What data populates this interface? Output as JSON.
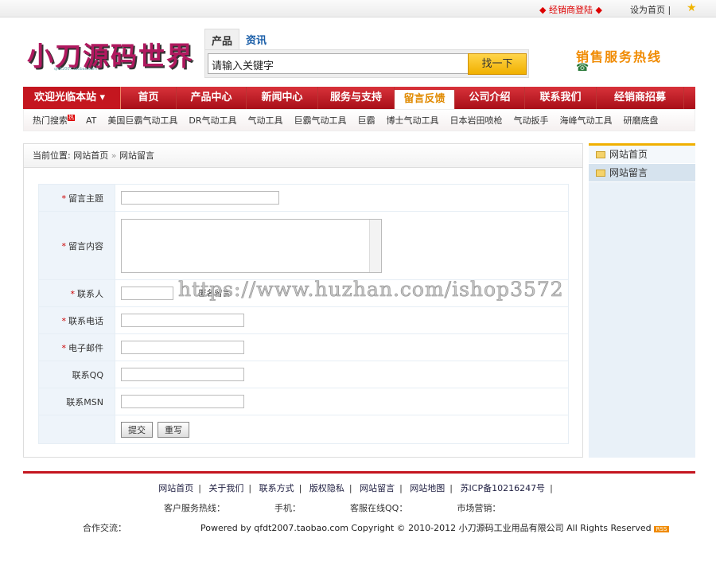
{
  "topbar": {
    "dealer_login": "◆ 经销商登陆 ◆",
    "set_home": "设为首页 |"
  },
  "logo": {
    "text": "小刀源码世界",
    "sub": "qfdt2007.taobao.com"
  },
  "search": {
    "tabs": [
      "产品",
      "资讯"
    ],
    "placeholder": "请输入关键字",
    "button": "找一下"
  },
  "hotline": {
    "title": "销售服务热线",
    "icon": "phone-icon"
  },
  "nav": {
    "welcome": "欢迎光临本站 ▾",
    "items": [
      "首页",
      "产品中心",
      "新闻中心",
      "服务与支持",
      "留言反馈",
      "公司介绍",
      "联系我们",
      "经销商招募"
    ],
    "active": "留言反馈"
  },
  "hot_search": {
    "label": "热门搜索",
    "badge": "热",
    "items": [
      "AT",
      "美国巨霸气动工具",
      "DR气动工具",
      "气动工具",
      "巨霸气动工具",
      "巨霸",
      "博士气动工具",
      "日本岩田喷枪",
      "气动扳手",
      "海峰气动工具",
      "研磨底盘"
    ]
  },
  "breadcrumb": {
    "prefix": "当前位置:",
    "home": "网站首页",
    "sep": "»",
    "current": "网站留言"
  },
  "form": {
    "required": "*",
    "subject": "留言主题",
    "content": "留言内容",
    "contact": "联系人",
    "anonymous": "匿名留言",
    "phone": "联系电话",
    "email": "电子邮件",
    "qq": "联系QQ",
    "msn": "联系MSN",
    "submit": "提交",
    "reset": "重写"
  },
  "sidebar": {
    "items": [
      "网站首页",
      "网站留言"
    ],
    "active": "网站留言"
  },
  "watermark": "https://www.huzhan.com/ishop3572",
  "footer": {
    "links": [
      "网站首页",
      "关于我们",
      "联系方式",
      "版权隐私",
      "网站留言",
      "网站地图",
      "苏ICP备10216247号"
    ],
    "info": [
      "客户服务热线：",
      "手机：",
      "客服在线QQ：",
      "市场营销："
    ],
    "coop": "合作交流：",
    "powered": "Powered by qfdt2007.taobao.com Copyright © 2010-2012 小刀源码工业用品有限公司 All Rights Reserved",
    "rss": "RSS"
  },
  "colors": {
    "brand_red": "#c4161f",
    "accent_orange": "#f08a00"
  }
}
